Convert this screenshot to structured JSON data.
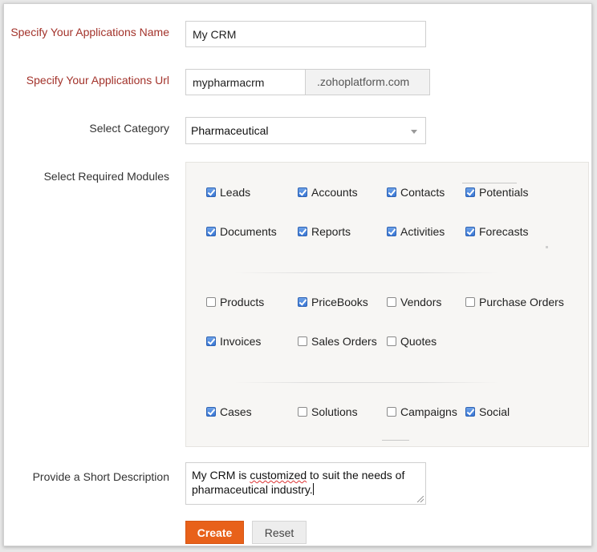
{
  "form": {
    "app_name_label": "Specify Your Applications Name",
    "app_name_value": "My CRM",
    "app_url_label": "Specify Your Applications Url",
    "app_url_value": "mypharmacrm",
    "app_url_suffix": ".zohoplatform.com",
    "category_label": "Select Category",
    "category_value": "Pharmaceutical",
    "modules_label": "Select Required Modules",
    "description_label": "Provide a Short Description",
    "description": {
      "part1": "My CRM is ",
      "misspelled": "customized",
      "part2": " to suit the needs of pharmaceutical industry."
    }
  },
  "modules": {
    "leads": {
      "label": "Leads",
      "checked": true
    },
    "accounts": {
      "label": "Accounts",
      "checked": true
    },
    "contacts": {
      "label": "Contacts",
      "checked": true
    },
    "potentials": {
      "label": "Potentials",
      "checked": true
    },
    "documents": {
      "label": "Documents",
      "checked": true
    },
    "reports": {
      "label": "Reports",
      "checked": true
    },
    "activities": {
      "label": "Activities",
      "checked": true
    },
    "forecasts": {
      "label": "Forecasts",
      "checked": true
    },
    "products": {
      "label": "Products",
      "checked": false
    },
    "pricebooks": {
      "label": "PriceBooks",
      "checked": true
    },
    "vendors": {
      "label": "Vendors",
      "checked": false
    },
    "purchase_orders": {
      "label": "Purchase Orders",
      "checked": false
    },
    "invoices": {
      "label": "Invoices",
      "checked": true
    },
    "sales_orders": {
      "label": "Sales Orders",
      "checked": false
    },
    "quotes": {
      "label": "Quotes",
      "checked": false
    },
    "cases": {
      "label": "Cases",
      "checked": true
    },
    "solutions": {
      "label": "Solutions",
      "checked": false
    },
    "campaigns": {
      "label": "Campaigns",
      "checked": false
    },
    "social": {
      "label": "Social",
      "checked": true
    }
  },
  "buttons": {
    "create": "Create",
    "reset": "Reset"
  },
  "colors": {
    "required_label": "#a3332b",
    "primary_button": "#e8611a",
    "checkbox_checked": "#3a78d6"
  },
  "icons": {
    "dropdown": "chevron-down-icon",
    "checkbox": "checkbox-icon"
  }
}
